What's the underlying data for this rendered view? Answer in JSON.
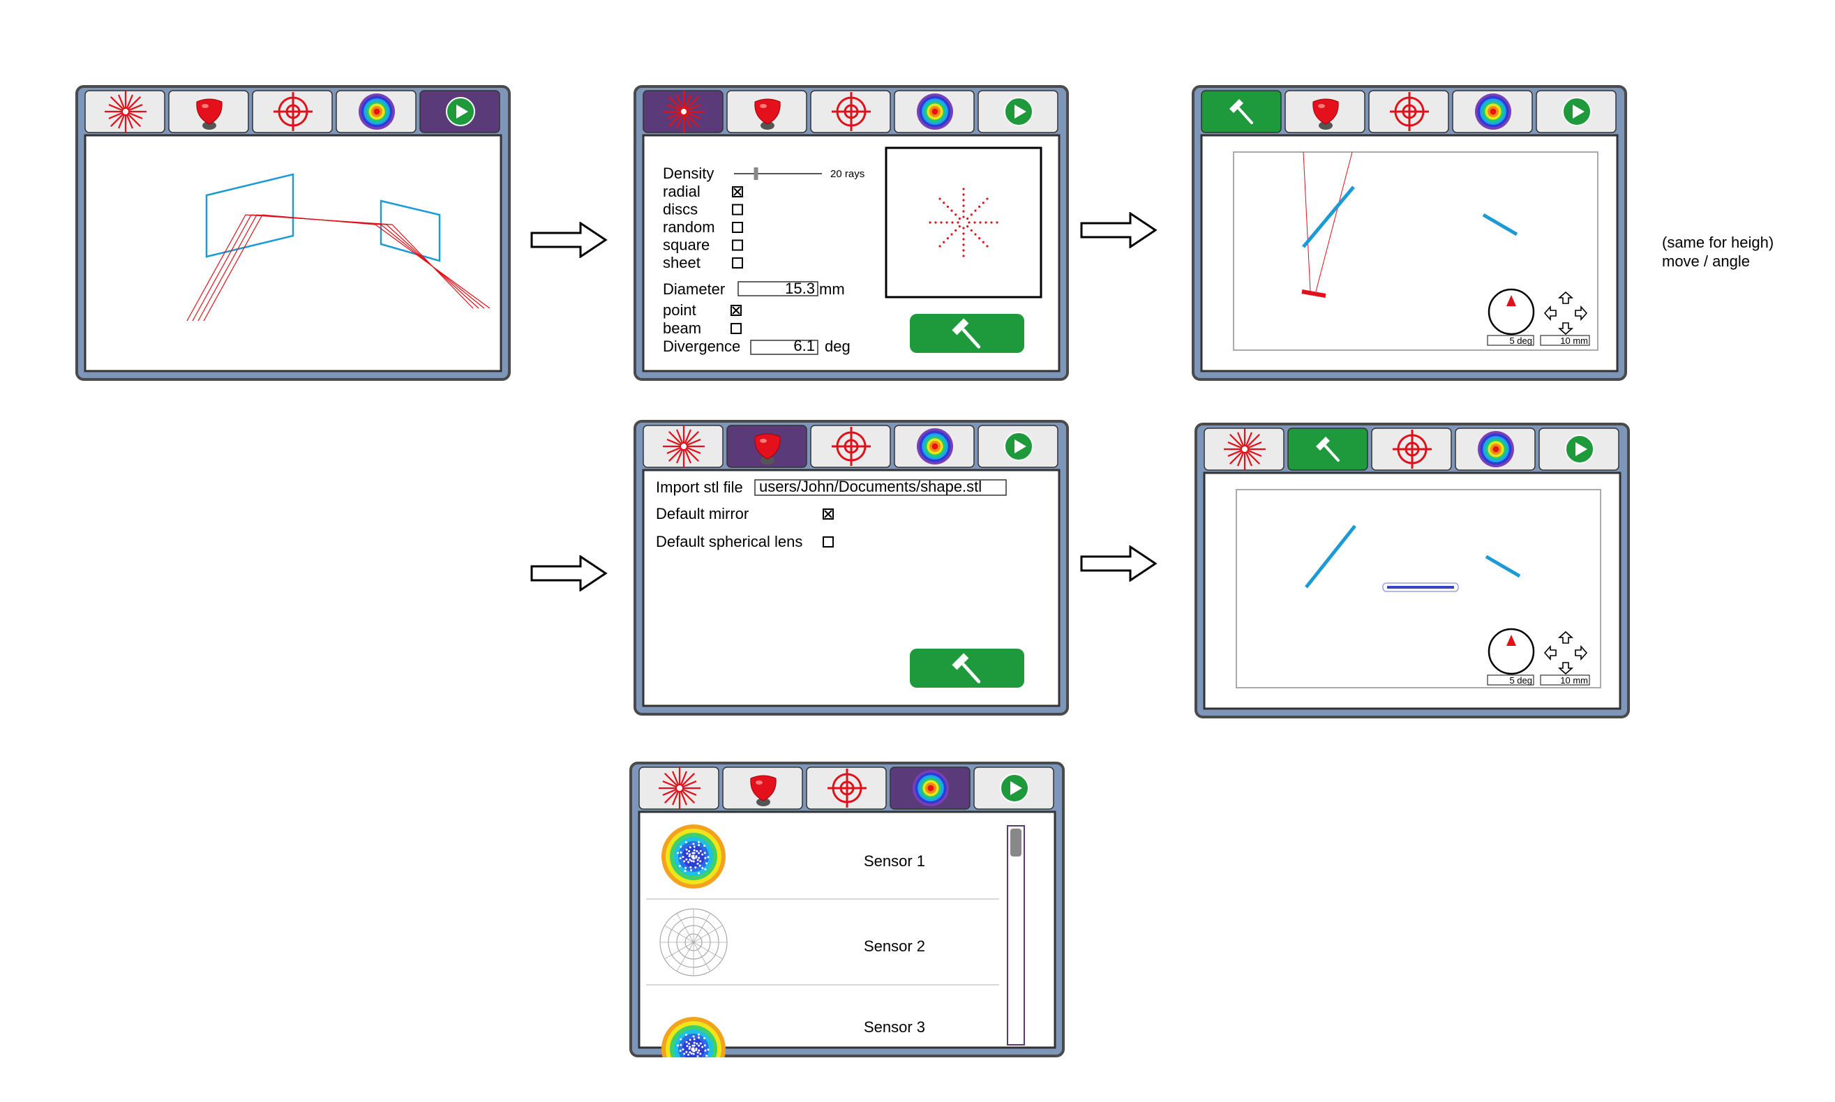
{
  "tabs": [
    {
      "icon": "ray-source-icon"
    },
    {
      "icon": "red-lens-icon"
    },
    {
      "icon": "crosshair-target-icon"
    },
    {
      "icon": "rainbow-sensor-icon"
    },
    {
      "icon": "play-icon"
    }
  ],
  "build_icon": "hammer-icon",
  "colors": {
    "frame": "#7f96bb",
    "frame_border": "#4a4a4a",
    "tab_bg": "#ebebeb",
    "tab_active": "#5b3a7a",
    "tab_build": "#1e9a3c",
    "red": "#e0111a",
    "blue": "#1c9ad6",
    "green_button": "#1e9a3c",
    "dark_blue": "#3943c6"
  },
  "panels": {
    "source": {
      "density_label": "Density",
      "density_value": "20 rays",
      "density_level": 0.25,
      "options": [
        {
          "label": "radial",
          "checked": true
        },
        {
          "label": "discs",
          "checked": false
        },
        {
          "label": "random",
          "checked": false
        },
        {
          "label": "square",
          "checked": false
        },
        {
          "label": "sheet",
          "checked": false
        }
      ],
      "diameter_label": "Diameter",
      "diameter_value": "15.3",
      "diameter_unit": "mm",
      "beam_options": [
        {
          "label": "point",
          "checked": true
        },
        {
          "label": "beam",
          "checked": false
        }
      ],
      "divergence_label": "Divergence",
      "divergence_value": "6.1",
      "divergence_unit": "deg"
    },
    "element": {
      "import_label": "Import stl file",
      "import_value": "users/John/Documents/shape.stl",
      "options": [
        {
          "label": "Default mirror",
          "checked": true
        },
        {
          "label": "Default spherical lens",
          "checked": false
        }
      ]
    },
    "placement": {
      "angle_step": "5 deg",
      "move_step": "10 mm"
    },
    "sensors": {
      "items": [
        {
          "label": "Sensor 1",
          "thumb": "heatmap"
        },
        {
          "label": "Sensor 2",
          "thumb": "empty-polar"
        },
        {
          "label": "Sensor 3",
          "thumb": "heatmap"
        }
      ]
    }
  },
  "note": [
    "(same for heigh)",
    "move / angle"
  ]
}
